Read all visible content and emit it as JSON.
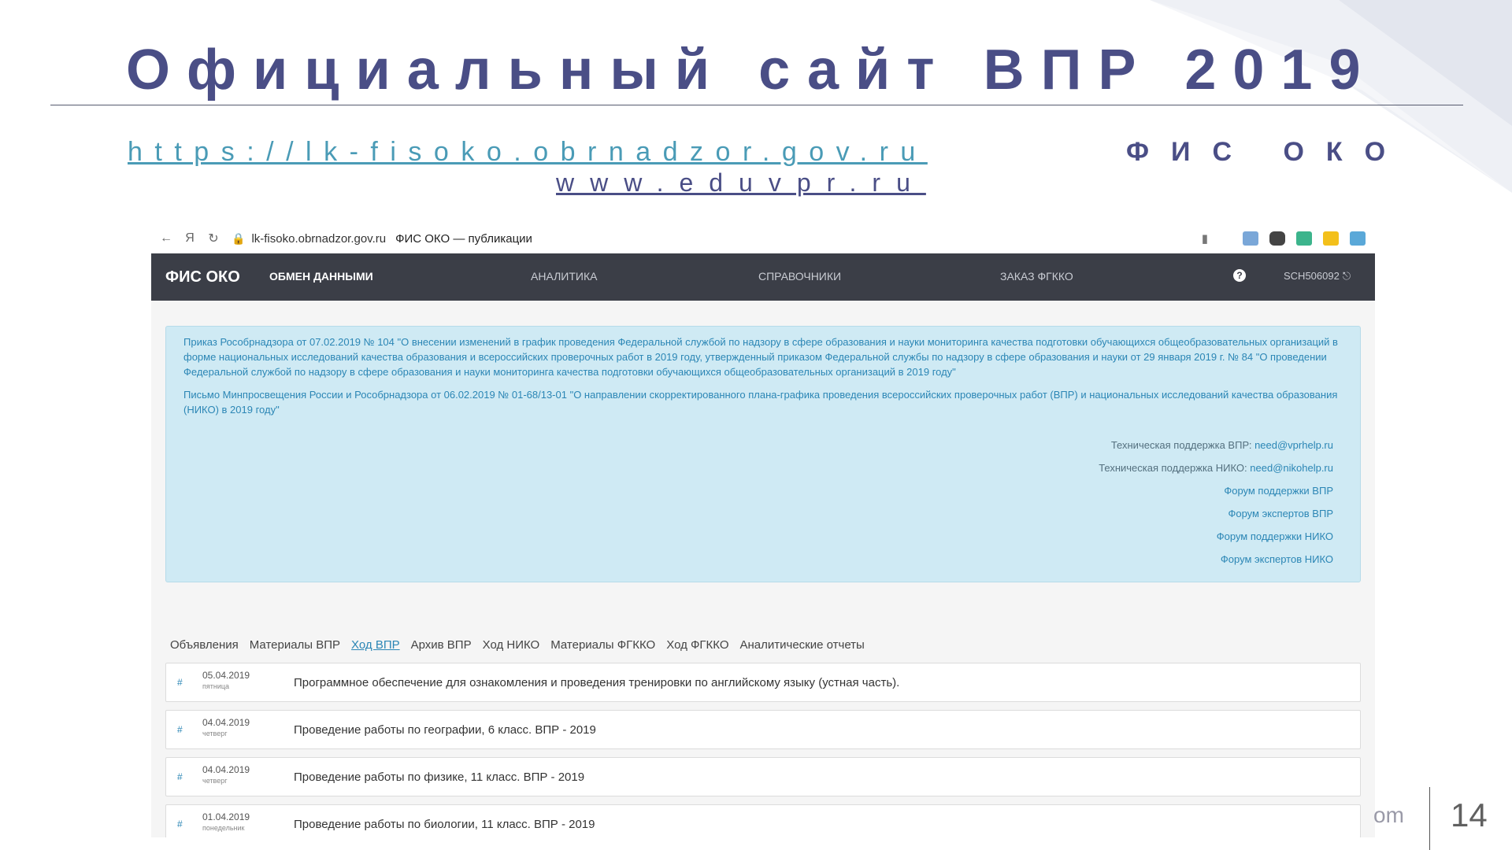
{
  "slide": {
    "title": "Официальный сайт ВПР 2019",
    "link_fis": "https://lk-fisoko.obrnadzor.gov.ru",
    "fis_label": "ФИС ОКО",
    "link_edu": "www.eduvpr.ru",
    "footer_fragment": "om",
    "page_number": "14",
    "colors": {
      "title": "#4a4e86",
      "link": "#4a9bb6"
    }
  },
  "browser": {
    "url": "lk-fisoko.obrnadzor.gov.ru",
    "tab_title": "ФИС ОКО — публикации",
    "yandex_glyph": "Я"
  },
  "app": {
    "brand": "ФИС ОКО",
    "nav": [
      {
        "label": "ОБМЕН ДАННЫМИ"
      },
      {
        "label": "АНАЛИТИКА"
      },
      {
        "label": "СПРАВОЧНИКИ"
      },
      {
        "label": "ЗАКАЗ ФГККО"
      }
    ],
    "help_glyph": "?",
    "user": "SCH506092",
    "colors": {
      "nav_bg": "#3b3e47",
      "notice_bg": "#cfeaf4",
      "notice_text": "#2b86b5"
    }
  },
  "notice": {
    "paragraphs": [
      "Приказ Рособрнадзора от 07.02.2019 № 104 \"О внесении изменений в график проведения Федеральной службой по надзору в сфере образования и науки мониторинга качества подготовки обучающихся общеобразовательных организаций в форме национальных исследований качества образования и всероссийских проверочных работ в 2019 году, утвержденный приказом Федеральной службы по надзору в сфере образования и науки от 29 января 2019 г. № 84 \"О проведении Федеральной службой по надзору в сфере образования и науки мониторинга качества подготовки обучающихся общеобразовательных организаций в 2019 году\"",
      "Письмо Минпросвещения России и Рособрнадзора от 06.02.2019 № 01-68/13-01 \"О направлении скорректированного плана-графика проведения всероссийских проверочных работ (ВПР) и национальных исследований качества образования (НИКО) в 2019 году\""
    ],
    "support_vpr_label": "Техническая поддержка ВПР:",
    "support_vpr_email": "need@vprhelp.ru",
    "support_niko_label": "Техническая поддержка НИКО:",
    "support_niko_email": "need@nikohelp.ru",
    "links": [
      "Форум поддержки ВПР",
      "Форум экспертов ВПР",
      "Форум поддержки НИКО",
      "Форум экспертов НИКО"
    ]
  },
  "tabs": [
    "Объявления",
    "Материалы ВПР",
    "Ход ВПР",
    "Архив ВПР",
    "Ход НИКО",
    "Материалы ФГККО",
    "Ход ФГККО",
    "Аналитические отчеты"
  ],
  "selected_tab": "Ход ВПР",
  "rows": [
    {
      "hash": "#",
      "date": "05.04.2019",
      "weekday": "пятница",
      "title": "Программное обеспечение для ознакомления и проведения тренировки по английскому языку (устная часть)."
    },
    {
      "hash": "#",
      "date": "04.04.2019",
      "weekday": "четверг",
      "title": "Проведение работы по географии, 6 класс. ВПР - 2019"
    },
    {
      "hash": "#",
      "date": "04.04.2019",
      "weekday": "четверг",
      "title": "Проведение работы по физике, 11 класс. ВПР - 2019"
    },
    {
      "hash": "#",
      "date": "01.04.2019",
      "weekday": "понедельник",
      "title": "Проведение работы по биологии, 11 класс. ВПР - 2019"
    }
  ]
}
